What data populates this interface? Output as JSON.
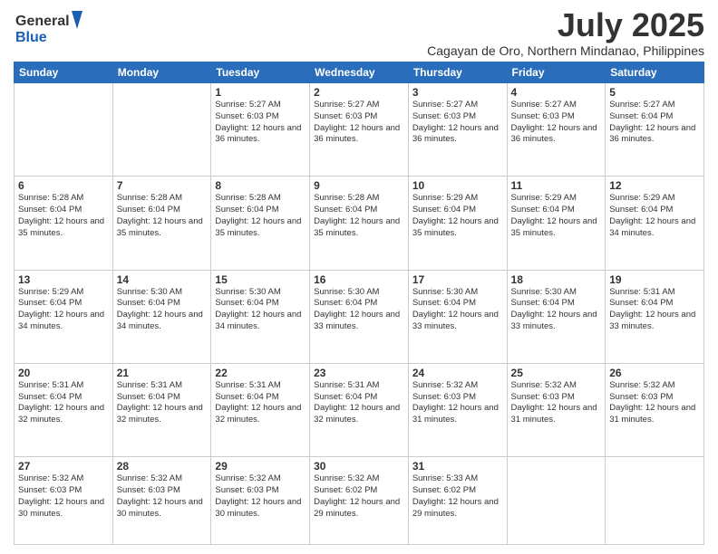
{
  "header": {
    "logo_line1": "General",
    "logo_line2": "Blue",
    "title": "July 2025",
    "subtitle": "Cagayan de Oro, Northern Mindanao, Philippines"
  },
  "days_of_week": [
    "Sunday",
    "Monday",
    "Tuesday",
    "Wednesday",
    "Thursday",
    "Friday",
    "Saturday"
  ],
  "weeks": [
    [
      {
        "day": "",
        "text": ""
      },
      {
        "day": "",
        "text": ""
      },
      {
        "day": "1",
        "text": "Sunrise: 5:27 AM\nSunset: 6:03 PM\nDaylight: 12 hours and 36 minutes."
      },
      {
        "day": "2",
        "text": "Sunrise: 5:27 AM\nSunset: 6:03 PM\nDaylight: 12 hours and 36 minutes."
      },
      {
        "day": "3",
        "text": "Sunrise: 5:27 AM\nSunset: 6:03 PM\nDaylight: 12 hours and 36 minutes."
      },
      {
        "day": "4",
        "text": "Sunrise: 5:27 AM\nSunset: 6:03 PM\nDaylight: 12 hours and 36 minutes."
      },
      {
        "day": "5",
        "text": "Sunrise: 5:27 AM\nSunset: 6:04 PM\nDaylight: 12 hours and 36 minutes."
      }
    ],
    [
      {
        "day": "6",
        "text": "Sunrise: 5:28 AM\nSunset: 6:04 PM\nDaylight: 12 hours and 35 minutes."
      },
      {
        "day": "7",
        "text": "Sunrise: 5:28 AM\nSunset: 6:04 PM\nDaylight: 12 hours and 35 minutes."
      },
      {
        "day": "8",
        "text": "Sunrise: 5:28 AM\nSunset: 6:04 PM\nDaylight: 12 hours and 35 minutes."
      },
      {
        "day": "9",
        "text": "Sunrise: 5:28 AM\nSunset: 6:04 PM\nDaylight: 12 hours and 35 minutes."
      },
      {
        "day": "10",
        "text": "Sunrise: 5:29 AM\nSunset: 6:04 PM\nDaylight: 12 hours and 35 minutes."
      },
      {
        "day": "11",
        "text": "Sunrise: 5:29 AM\nSunset: 6:04 PM\nDaylight: 12 hours and 35 minutes."
      },
      {
        "day": "12",
        "text": "Sunrise: 5:29 AM\nSunset: 6:04 PM\nDaylight: 12 hours and 34 minutes."
      }
    ],
    [
      {
        "day": "13",
        "text": "Sunrise: 5:29 AM\nSunset: 6:04 PM\nDaylight: 12 hours and 34 minutes."
      },
      {
        "day": "14",
        "text": "Sunrise: 5:30 AM\nSunset: 6:04 PM\nDaylight: 12 hours and 34 minutes."
      },
      {
        "day": "15",
        "text": "Sunrise: 5:30 AM\nSunset: 6:04 PM\nDaylight: 12 hours and 34 minutes."
      },
      {
        "day": "16",
        "text": "Sunrise: 5:30 AM\nSunset: 6:04 PM\nDaylight: 12 hours and 33 minutes."
      },
      {
        "day": "17",
        "text": "Sunrise: 5:30 AM\nSunset: 6:04 PM\nDaylight: 12 hours and 33 minutes."
      },
      {
        "day": "18",
        "text": "Sunrise: 5:30 AM\nSunset: 6:04 PM\nDaylight: 12 hours and 33 minutes."
      },
      {
        "day": "19",
        "text": "Sunrise: 5:31 AM\nSunset: 6:04 PM\nDaylight: 12 hours and 33 minutes."
      }
    ],
    [
      {
        "day": "20",
        "text": "Sunrise: 5:31 AM\nSunset: 6:04 PM\nDaylight: 12 hours and 32 minutes."
      },
      {
        "day": "21",
        "text": "Sunrise: 5:31 AM\nSunset: 6:04 PM\nDaylight: 12 hours and 32 minutes."
      },
      {
        "day": "22",
        "text": "Sunrise: 5:31 AM\nSunset: 6:04 PM\nDaylight: 12 hours and 32 minutes."
      },
      {
        "day": "23",
        "text": "Sunrise: 5:31 AM\nSunset: 6:04 PM\nDaylight: 12 hours and 32 minutes."
      },
      {
        "day": "24",
        "text": "Sunrise: 5:32 AM\nSunset: 6:03 PM\nDaylight: 12 hours and 31 minutes."
      },
      {
        "day": "25",
        "text": "Sunrise: 5:32 AM\nSunset: 6:03 PM\nDaylight: 12 hours and 31 minutes."
      },
      {
        "day": "26",
        "text": "Sunrise: 5:32 AM\nSunset: 6:03 PM\nDaylight: 12 hours and 31 minutes."
      }
    ],
    [
      {
        "day": "27",
        "text": "Sunrise: 5:32 AM\nSunset: 6:03 PM\nDaylight: 12 hours and 30 minutes."
      },
      {
        "day": "28",
        "text": "Sunrise: 5:32 AM\nSunset: 6:03 PM\nDaylight: 12 hours and 30 minutes."
      },
      {
        "day": "29",
        "text": "Sunrise: 5:32 AM\nSunset: 6:03 PM\nDaylight: 12 hours and 30 minutes."
      },
      {
        "day": "30",
        "text": "Sunrise: 5:32 AM\nSunset: 6:02 PM\nDaylight: 12 hours and 29 minutes."
      },
      {
        "day": "31",
        "text": "Sunrise: 5:33 AM\nSunset: 6:02 PM\nDaylight: 12 hours and 29 minutes."
      },
      {
        "day": "",
        "text": ""
      },
      {
        "day": "",
        "text": ""
      }
    ]
  ]
}
